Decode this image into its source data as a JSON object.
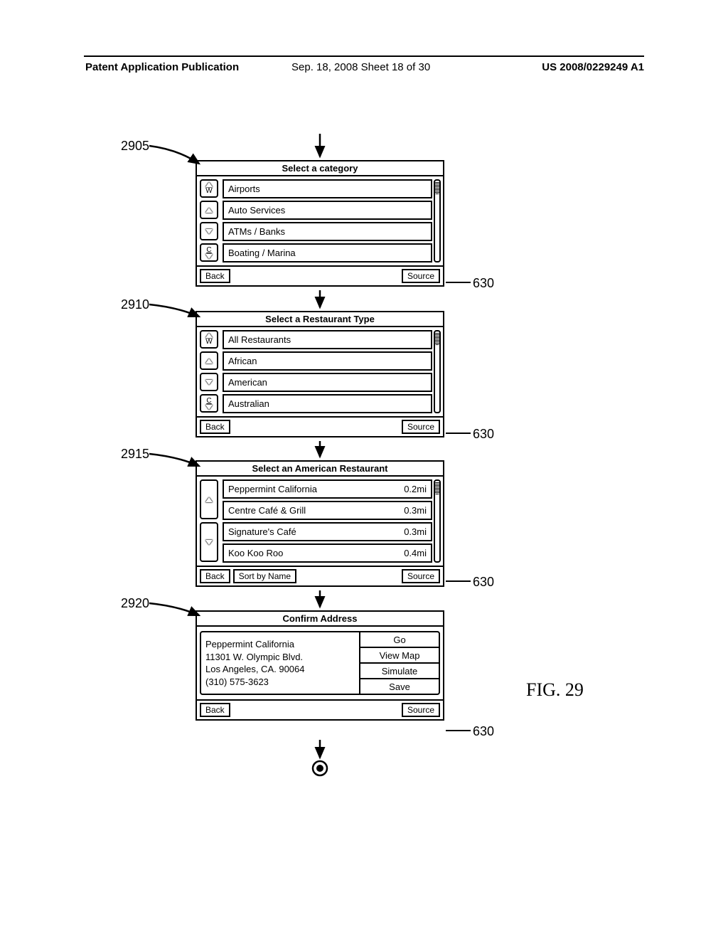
{
  "header": {
    "left": "Patent Application Publication",
    "mid": "Sep. 18, 2008  Sheet 18 of 30",
    "right": "US 2008/0229249 A1"
  },
  "refs": {
    "p1": "2905",
    "p2": "2910",
    "p3": "2915",
    "p4": "2920",
    "src": "630"
  },
  "fig_label": "FIG. 29",
  "panel1": {
    "title": "Select a category",
    "items": [
      "Airports",
      "Auto Services",
      "ATMs / Banks",
      "Boating / Marina"
    ],
    "back": "Back",
    "source": "Source"
  },
  "panel2": {
    "title": "Select a Restaurant Type",
    "items": [
      "All Restaurants",
      "African",
      "American",
      "Australian"
    ],
    "back": "Back",
    "source": "Source"
  },
  "panel3": {
    "title": "Select an American Restaurant",
    "items": [
      {
        "name": "Peppermint California",
        "dist": "0.2mi"
      },
      {
        "name": "Centre Café & Grill",
        "dist": "0.3mi"
      },
      {
        "name": "Signature's Café",
        "dist": "0.3mi"
      },
      {
        "name": "Koo Koo Roo",
        "dist": "0.4mi"
      }
    ],
    "back": "Back",
    "sort": "Sort by Name",
    "source": "Source"
  },
  "panel4": {
    "title": "Confirm Address",
    "address": {
      "l1": "Peppermint California",
      "l2": "11301 W. Olympic Blvd.",
      "l3": "Los Angeles, CA. 90064",
      "l4": "(310) 575-3623"
    },
    "actions": [
      "Go",
      "View Map",
      "Simulate",
      "Save"
    ],
    "back": "Back",
    "source": "Source"
  }
}
